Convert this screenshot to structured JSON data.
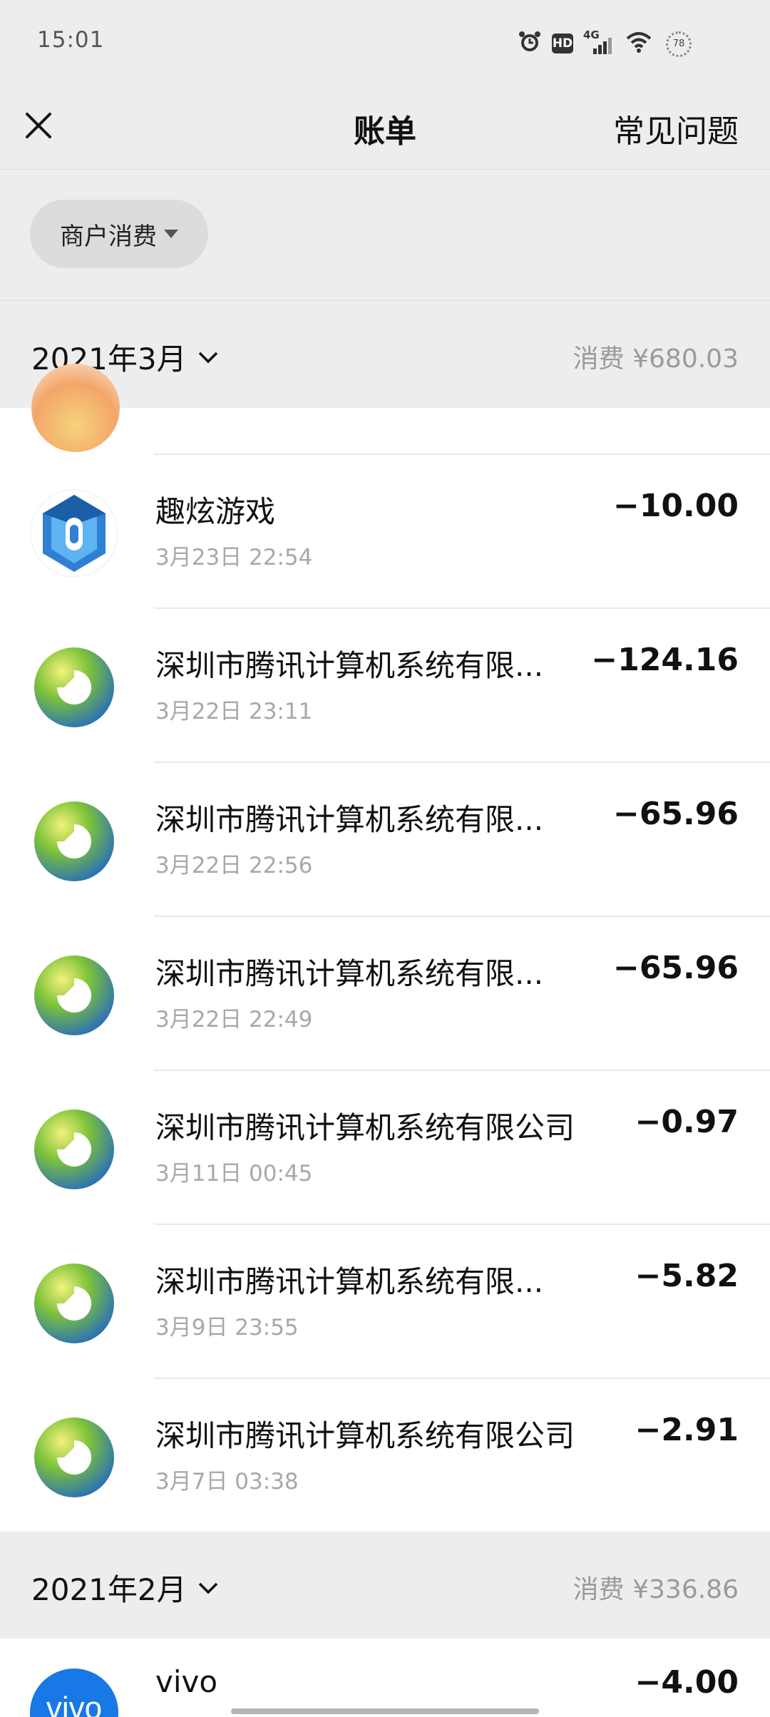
{
  "status_bar": {
    "time": "15:01",
    "network": "4G",
    "hd": "HD",
    "battery": "78"
  },
  "nav": {
    "title": "账单",
    "help": "常见问题"
  },
  "filter": {
    "label": "商户消费"
  },
  "months": [
    {
      "label": "2021年3月",
      "total": "消费 ¥680.03"
    },
    {
      "label": "2021年2月",
      "total": "消费 ¥336.86"
    }
  ],
  "transactions": [
    {
      "name": "趣炫游戏",
      "time": "3月23日 22:54",
      "amount": "−10.00",
      "icon": "hexagon-game-icon"
    },
    {
      "name": "深圳市腾讯计算机系统有限...",
      "time": "3月22日 23:11",
      "amount": "−124.16",
      "icon": "tencent-logo-icon"
    },
    {
      "name": "深圳市腾讯计算机系统有限...",
      "time": "3月22日 22:56",
      "amount": "−65.96",
      "icon": "tencent-logo-icon"
    },
    {
      "name": "深圳市腾讯计算机系统有限...",
      "time": "3月22日 22:49",
      "amount": "−65.96",
      "icon": "tencent-logo-icon"
    },
    {
      "name": "深圳市腾讯计算机系统有限公司",
      "time": "3月11日 00:45",
      "amount": "−0.97",
      "icon": "tencent-logo-icon"
    },
    {
      "name": "深圳市腾讯计算机系统有限...",
      "time": "3月9日 23:55",
      "amount": "−5.82",
      "icon": "tencent-logo-icon"
    },
    {
      "name": "深圳市腾讯计算机系统有限公司",
      "time": "3月7日 03:38",
      "amount": "−2.91",
      "icon": "tencent-logo-icon"
    }
  ],
  "feb_transactions": [
    {
      "name": "vivo",
      "amount": "−4.00",
      "icon": "vivo-logo-icon"
    }
  ],
  "colors": {
    "background": "#ededed",
    "muted_text": "#a8a8a8",
    "vivo_blue": "#1778e6"
  }
}
